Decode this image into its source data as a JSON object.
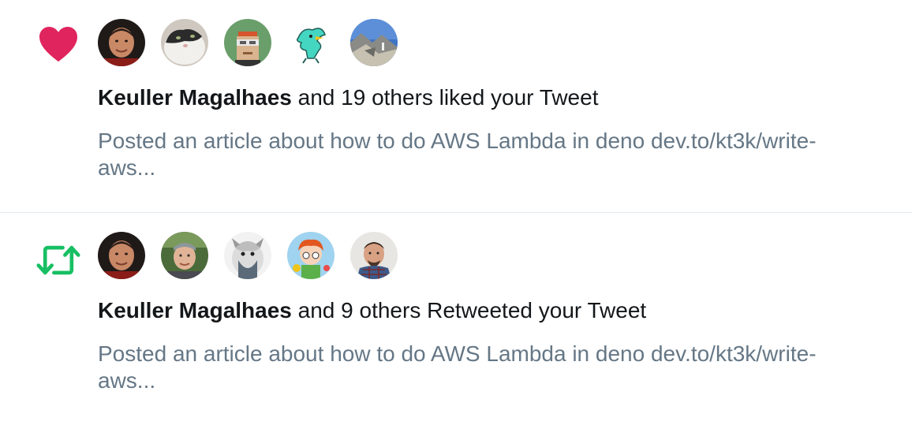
{
  "notifications": [
    {
      "type_icon": "heart-icon",
      "accent_color": "#e0245e",
      "actor_name": "Keuller Magalhaes",
      "action_text": " and 19 others liked your Tweet",
      "tweet_text_line1": "Posted an article about how to do AWS Lambda in deno dev.to/kt3k/write-",
      "tweet_text_line2": "aws...",
      "avatars": [
        "avatar-keuller",
        "avatar-cat",
        "avatar-pixel-character",
        "avatar-woodstock",
        "avatar-mountain"
      ]
    },
    {
      "type_icon": "retweet-icon",
      "accent_color": "#17bf63",
      "actor_name": "Keuller Magalhaes",
      "action_text": " and 9 others Retweeted your Tweet",
      "tweet_text_line1": "Posted an article about how to do AWS Lambda in deno dev.to/kt3k/write-",
      "tweet_text_line2": "aws...",
      "avatars": [
        "avatar-keuller",
        "avatar-man-beanie",
        "avatar-animal-bw",
        "avatar-cartoon",
        "avatar-man-plaid"
      ]
    }
  ]
}
